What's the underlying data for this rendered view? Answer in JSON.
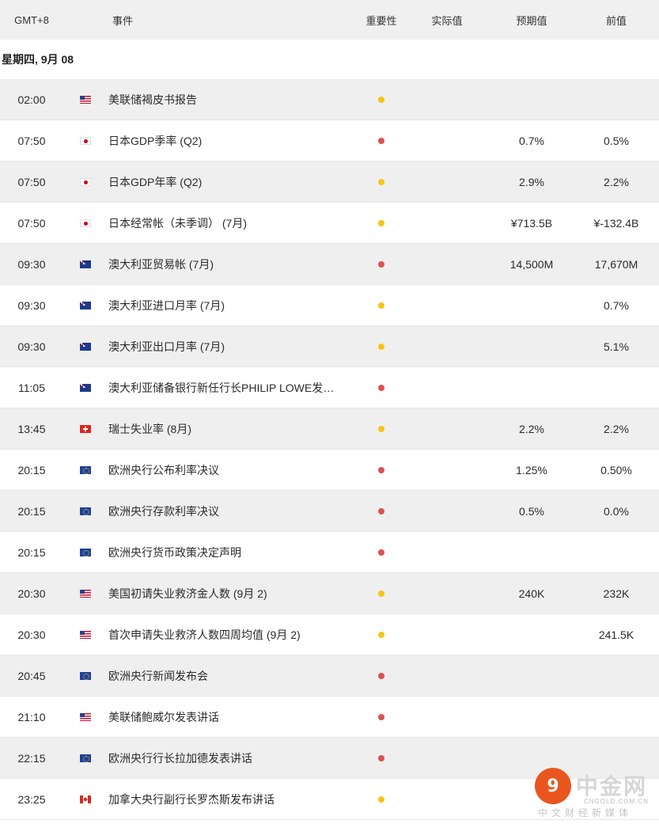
{
  "header": {
    "time": "GMT+8",
    "event": "事件",
    "importance": "重要性",
    "actual": "实际值",
    "forecast": "预期值",
    "previous": "前值"
  },
  "date_label": "星期四, 9月 08",
  "colors": {
    "high": "#d9534f",
    "medium": "#f5c518"
  },
  "events": [
    {
      "time": "02:00",
      "flag": "us",
      "event": "美联储褐皮书报告",
      "importance": "medium",
      "actual": "",
      "forecast": "",
      "previous": ""
    },
    {
      "time": "07:50",
      "flag": "jp",
      "event": "日本GDP季率 (Q2)",
      "importance": "high",
      "actual": "",
      "forecast": "0.7%",
      "previous": "0.5%"
    },
    {
      "time": "07:50",
      "flag": "jp",
      "event": "日本GDP年率 (Q2)",
      "importance": "medium",
      "actual": "",
      "forecast": "2.9%",
      "previous": "2.2%"
    },
    {
      "time": "07:50",
      "flag": "jp",
      "event": "日本经常帐（未季调） (7月)",
      "importance": "medium",
      "actual": "",
      "forecast": "¥713.5B",
      "previous": "¥-132.4B"
    },
    {
      "time": "09:30",
      "flag": "au",
      "event": "澳大利亚贸易帐 (7月)",
      "importance": "high",
      "actual": "",
      "forecast": "14,500M",
      "previous": "17,670M"
    },
    {
      "time": "09:30",
      "flag": "au",
      "event": "澳大利亚进口月率 (7月)",
      "importance": "medium",
      "actual": "",
      "forecast": "",
      "previous": "0.7%"
    },
    {
      "time": "09:30",
      "flag": "au",
      "event": "澳大利亚出口月率 (7月)",
      "importance": "medium",
      "actual": "",
      "forecast": "",
      "previous": "5.1%"
    },
    {
      "time": "11:05",
      "flag": "au",
      "event": "澳大利亚储备银行新任行长PHILIP LOWE发…",
      "importance": "high",
      "actual": "",
      "forecast": "",
      "previous": ""
    },
    {
      "time": "13:45",
      "flag": "ch",
      "event": "瑞士失业率 (8月)",
      "importance": "medium",
      "actual": "",
      "forecast": "2.2%",
      "previous": "2.2%"
    },
    {
      "time": "20:15",
      "flag": "eu",
      "event": "欧洲央行公布利率决议",
      "importance": "high",
      "actual": "",
      "forecast": "1.25%",
      "previous": "0.50%"
    },
    {
      "time": "20:15",
      "flag": "eu",
      "event": "欧洲央行存款利率决议",
      "importance": "high",
      "actual": "",
      "forecast": "0.5%",
      "previous": "0.0%"
    },
    {
      "time": "20:15",
      "flag": "eu",
      "event": "欧洲央行货币政策决定声明",
      "importance": "high",
      "actual": "",
      "forecast": "",
      "previous": ""
    },
    {
      "time": "20:30",
      "flag": "us",
      "event": "美国初请失业救济金人数 (9月 2)",
      "importance": "medium",
      "actual": "",
      "forecast": "240K",
      "previous": "232K"
    },
    {
      "time": "20:30",
      "flag": "us",
      "event": "首次申请失业救济人数四周均值 (9月 2)",
      "importance": "medium",
      "actual": "",
      "forecast": "",
      "previous": "241.5K"
    },
    {
      "time": "20:45",
      "flag": "eu",
      "event": "欧洲央行新闻发布会",
      "importance": "high",
      "actual": "",
      "forecast": "",
      "previous": ""
    },
    {
      "time": "21:10",
      "flag": "us",
      "event": "美联储鲍威尔发表讲话",
      "importance": "high",
      "actual": "",
      "forecast": "",
      "previous": ""
    },
    {
      "time": "22:15",
      "flag": "eu",
      "event": "欧洲央行行长拉加德发表讲话",
      "importance": "high",
      "actual": "",
      "forecast": "",
      "previous": ""
    },
    {
      "time": "23:25",
      "flag": "ca",
      "event": "加拿大央行副行长罗杰斯发布讲话",
      "importance": "medium",
      "actual": "",
      "forecast": "",
      "previous": ""
    }
  ],
  "watermark": {
    "name": "中金网",
    "url": "CNGOLD.COM.CN",
    "tagline": "中文财经新媒体"
  }
}
